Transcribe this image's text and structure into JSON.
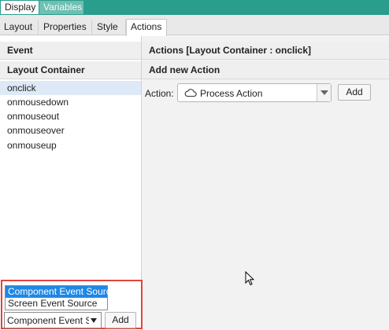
{
  "top_tabs": {
    "display": "Display",
    "variables": "Variables"
  },
  "tabs": [
    "Layout",
    "Properties",
    "Style",
    "Actions"
  ],
  "left": {
    "event_header": "Event",
    "container_header": "Layout Container",
    "events": [
      "onclick",
      "onmousedown",
      "onmouseout",
      "onmouseover",
      "onmouseup"
    ],
    "source_options": [
      "Component Event Source",
      "Screen Event Source"
    ],
    "source_selected": "Component Event Source",
    "add_label": "Add"
  },
  "right": {
    "actions_header": "Actions [Layout Container : onclick]",
    "add_new_header": "Add new Action",
    "action_label": "Action:",
    "action_value": "Process Action",
    "action_icon": "cloud-icon",
    "add_label": "Add"
  },
  "colors": {
    "accent": "#2a9d8c",
    "selection": "#1e88e5",
    "highlight": "#e0453d"
  }
}
